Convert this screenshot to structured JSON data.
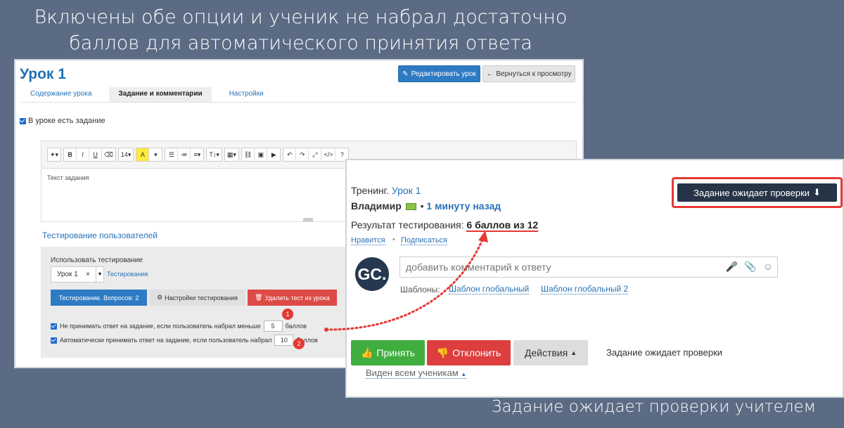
{
  "captions": {
    "top_line1": "Включены обе опции и ученик не набрал достаточно",
    "top_line2": "баллов для автоматического принятия ответа",
    "bottom": "Задание ожидает проверки учителем"
  },
  "editor": {
    "title": "Урок 1",
    "edit_button": "Редактировать урок",
    "back_button": "Вернуться к просмотру",
    "tabs": [
      {
        "label": "Содержание урока"
      },
      {
        "label": "Задание и комментарии",
        "active": true
      },
      {
        "label": "Настройки"
      }
    ],
    "has_task_label": "В уроке есть задание",
    "toolbar": {
      "font_size": "14"
    },
    "editor_placeholder": "Текст задания",
    "testing_link": "Тестирование пользователей",
    "testing": {
      "use_label": "Использовать тестирование",
      "select_value": "Урок 1",
      "select_clear": "×",
      "select_link": "Тестирования",
      "btn_questions": "Тестирование. Вопросов: 2",
      "btn_settings": "Настройки тестирования",
      "btn_delete": "Удалить тест из урока",
      "option1_text": "Не принимать ответ на задание, если пользователь набрал меньше",
      "option1_value": "5",
      "option1_unit": "баллов",
      "option2_text": "Автоматически принимать ответ на задание, если пользователь набрал",
      "option2_value": "10",
      "option2_unit": "баллов",
      "badge1": "1",
      "badge2": "2"
    }
  },
  "review": {
    "training_label": "Тренинг.",
    "training_link": "Урок 1",
    "user_name": "Владимир",
    "time_link": "1 минуту назад",
    "await_button": "Задание ожидает проверки",
    "result_label": "Результат тестирования:",
    "result_value": "6 баллов из 12",
    "like_link": "Нравится",
    "subscribe_link": "Подписаться",
    "avatar_text": "GC.",
    "comment_placeholder": "добавить комментарий к ответу",
    "templates_label": "Шаблоны:",
    "template1": "Шаблон глобальный",
    "template2": "Шаблон глобальный 2",
    "accept_button": "Принять",
    "reject_button": "Отклонить",
    "actions_button": "Действия",
    "status_text": "Задание ожидает проверки",
    "visibility_link": "Виден всем ученикам"
  }
}
